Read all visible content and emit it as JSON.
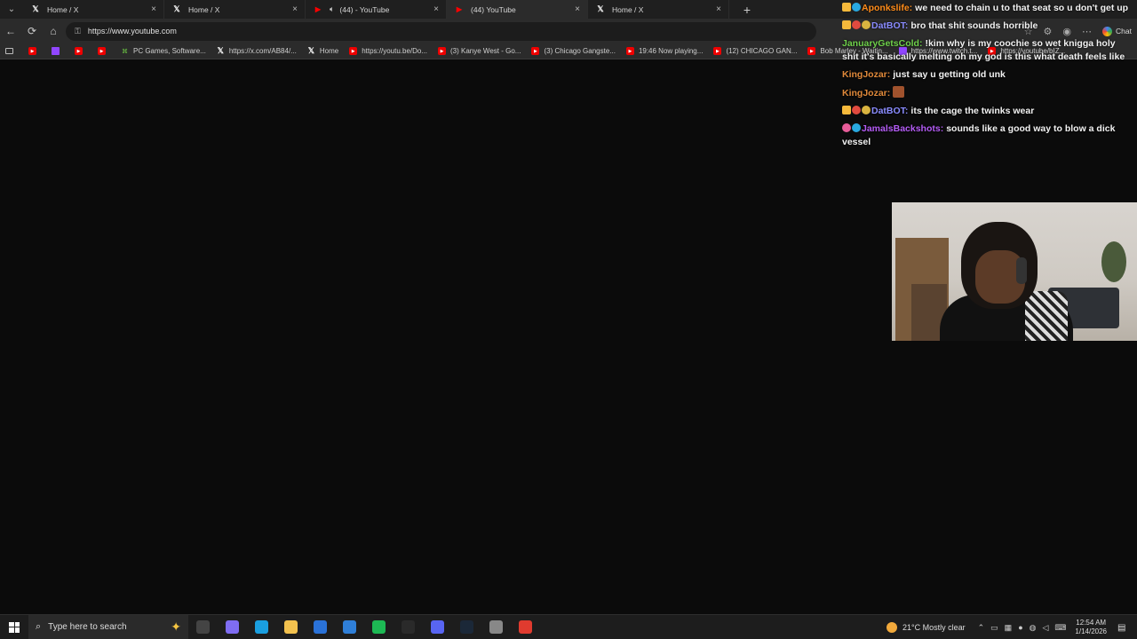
{
  "browser": {
    "tabs": [
      {
        "label": "Home / X",
        "icon": "x-logo-icon",
        "active": false,
        "audio": false
      },
      {
        "label": "Home / X",
        "icon": "x-logo-icon",
        "active": false,
        "audio": false
      },
      {
        "label": "(44) - YouTube",
        "icon": "youtube-icon",
        "active": false,
        "audio": true
      },
      {
        "label": "(44) YouTube",
        "icon": "youtube-icon",
        "active": true,
        "audio": false
      },
      {
        "label": "Home / X",
        "icon": "x-logo-icon",
        "active": false,
        "audio": false
      }
    ],
    "new_tab_symbol": "+",
    "url": "https://www.youtube.com",
    "chat_label": "Chat"
  },
  "bookmarks": [
    {
      "label": "",
      "icon": "youtube-icon"
    },
    {
      "label": "",
      "icon": "twitch-icon"
    },
    {
      "label": "",
      "icon": "youtube-icon"
    },
    {
      "label": "",
      "icon": "youtube-icon"
    },
    {
      "label": "PC Games, Software...",
      "icon": "pc-games-icon"
    },
    {
      "label": "https://x.com/AB84/...",
      "icon": "x-logo-icon"
    },
    {
      "label": "Home",
      "icon": "x-logo-icon"
    },
    {
      "label": "https://youtu.be/Do...",
      "icon": "youtube-icon"
    },
    {
      "label": "(3) Kanye West - Go...",
      "icon": "youtube-icon"
    },
    {
      "label": "(3) Chicago Gangste...",
      "icon": "youtube-icon"
    },
    {
      "label": "19:46 Now playing...",
      "icon": "youtube-icon"
    },
    {
      "label": "(12) CHICAGO GAN...",
      "icon": "youtube-icon"
    },
    {
      "label": "Bob Marley - Waitin...",
      "icon": "youtube-icon"
    },
    {
      "label": "https://www.twitch.t...",
      "icon": "twitch-icon"
    },
    {
      "label": "https://youtube/bIZ...",
      "icon": "youtube-icon"
    }
  ],
  "chat": [
    {
      "badges": [
        "crown",
        "gem"
      ],
      "user": "Aponkslife:",
      "color": "#ff8c1a",
      "text": "we need to chain u to that seat so u don't get up"
    },
    {
      "badges": [
        "crown",
        "red",
        "gold"
      ],
      "user": "DatBOT:",
      "color": "#8a8cff",
      "text": "bro that shit sounds horrible"
    },
    {
      "badges": [],
      "user": "JanuaryGetsCold:",
      "color": "#6fd04b",
      "text": "!kim why is my coochie so wet knigga holy shit it's basically melting oh my god is this what death feels like"
    },
    {
      "badges": [],
      "user": "KingJozar:",
      "color": "#e0893a",
      "text": "just say u getting old unk"
    },
    {
      "badges": [],
      "user": "KingJozar:",
      "color": "#e0893a",
      "text": "",
      "emote": true
    },
    {
      "badges": [
        "crown",
        "red",
        "gold"
      ],
      "user": "DatBOT:",
      "color": "#8a8cff",
      "text": "its the cage the twinks wear"
    },
    {
      "badges": [
        "pink",
        "gem"
      ],
      "user": "JamalsBackshots:",
      "color": "#b45cf5",
      "text": "sounds like a good way to blow a dick vessel"
    }
  ],
  "taskbar": {
    "search_placeholder": "Type here to search",
    "apps": [
      {
        "name": "task-view-icon",
        "color": "#444"
      },
      {
        "name": "copilot-icon",
        "color": "#7f6df2"
      },
      {
        "name": "edge-icon",
        "color": "#1a9fe0"
      },
      {
        "name": "file-explorer-icon",
        "color": "#f2c14e"
      },
      {
        "name": "store-icon",
        "color": "#2a72d8"
      },
      {
        "name": "photos-icon",
        "color": "#2f7fd8"
      },
      {
        "name": "spotify-icon",
        "color": "#1db954"
      },
      {
        "name": "obs-icon",
        "color": "#2a2a2a"
      },
      {
        "name": "discord-icon",
        "color": "#5865f2"
      },
      {
        "name": "steam-icon",
        "color": "#1b2838"
      },
      {
        "name": "app-icon",
        "color": "#888"
      },
      {
        "name": "recorder-icon",
        "color": "#e03b2f"
      }
    ],
    "weather_text": "21°C  Mostly clear",
    "time": "12:54 AM",
    "date": "1/14/2026"
  }
}
